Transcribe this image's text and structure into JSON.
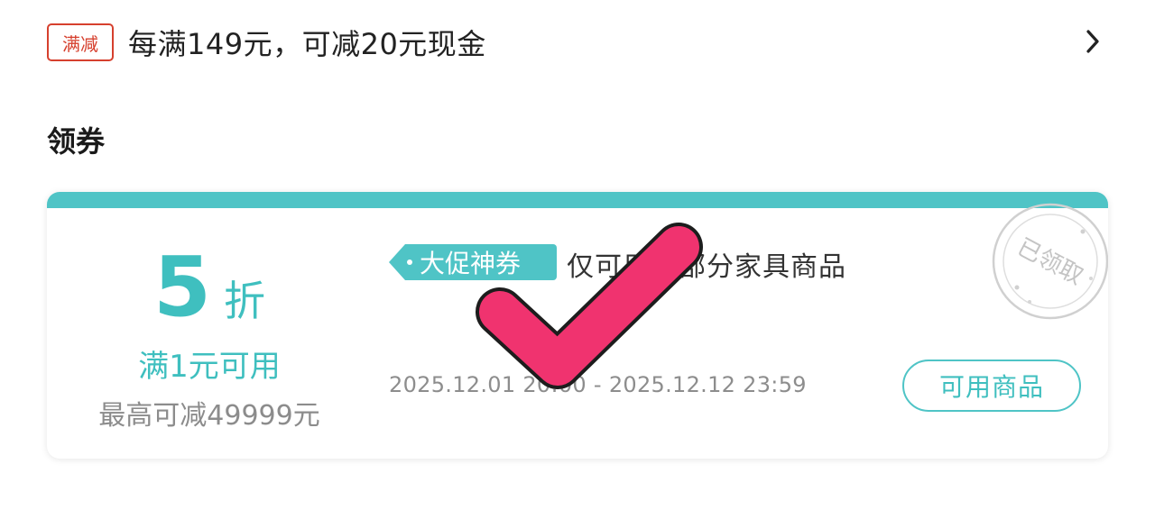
{
  "promo": {
    "tag": "满减",
    "text": "每满149元，可减20元现金",
    "chevron": "chevron-right-icon"
  },
  "section": {
    "title": "领券"
  },
  "coupon": {
    "discount_value": "5",
    "discount_unit": "折",
    "threshold": "满1元可用",
    "max_reduce": "最高可减49999元",
    "event_tag": "大促神券",
    "scope": "仅可用于部分家具商品",
    "validity": "2025.12.01 20:00 - 2025.12.12 23:59",
    "products_button": "可用商品",
    "claimed_stamp": "已领取"
  },
  "colors": {
    "accent_teal": "#4fc4c6",
    "promo_red": "#d6402e",
    "check_pink": "#f0336f",
    "muted_gray": "#8d8d8d"
  }
}
